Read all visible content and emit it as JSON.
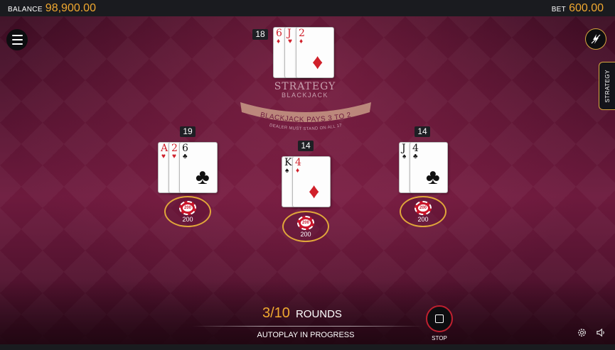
{
  "topbar": {
    "balance_label": "BALANCE",
    "balance_value": "98,900.00",
    "bet_label": "BET",
    "bet_value": "600.00"
  },
  "colors": {
    "accent_gold": "#f0a830",
    "felt": "#6d1a3d",
    "card_red": "#d0202a",
    "stop_ring": "#c02030"
  },
  "side_tab": {
    "label": "STRATEGY"
  },
  "table_logo": {
    "title": "STRATEGY",
    "subtitle": "BLACKJACK",
    "pays": "BLACKJACK PAYS 3 TO 2",
    "rule": "DEALER MUST STAND ON ALL 17"
  },
  "dealer": {
    "score": "18",
    "cards": [
      {
        "rank": "6",
        "suit": "♦",
        "color": "red"
      },
      {
        "rank": "J",
        "suit": "♥",
        "color": "red"
      },
      {
        "rank": "2",
        "suit": "♦",
        "color": "red"
      }
    ]
  },
  "hands": [
    {
      "score": "19",
      "cards": [
        {
          "rank": "A",
          "suit": "♥",
          "color": "red"
        },
        {
          "rank": "2",
          "suit": "♥",
          "color": "red"
        },
        {
          "rank": "6",
          "suit": "♣",
          "color": "black"
        }
      ],
      "chip_label": "200",
      "bet": "200"
    },
    {
      "score": "14",
      "cards": [
        {
          "rank": "K",
          "suit": "♠",
          "color": "black"
        },
        {
          "rank": "4",
          "suit": "♦",
          "color": "red"
        }
      ],
      "chip_label": "200",
      "bet": "200"
    },
    {
      "score": "14",
      "cards": [
        {
          "rank": "J",
          "suit": "♠",
          "color": "black"
        },
        {
          "rank": "4",
          "suit": "♣",
          "color": "black"
        }
      ],
      "chip_label": "200",
      "bet": "200"
    }
  ],
  "autoplay": {
    "rounds_count": "3/10",
    "rounds_label": "ROUNDS",
    "status": "AUTOPLAY IN PROGRESS",
    "stop_label": "STOP"
  },
  "icons": {
    "menu": "hamburger-icon",
    "turbo": "lightning-icon",
    "settings": "gear-icon",
    "sound": "speaker-icon",
    "stop": "stop-square-icon"
  }
}
